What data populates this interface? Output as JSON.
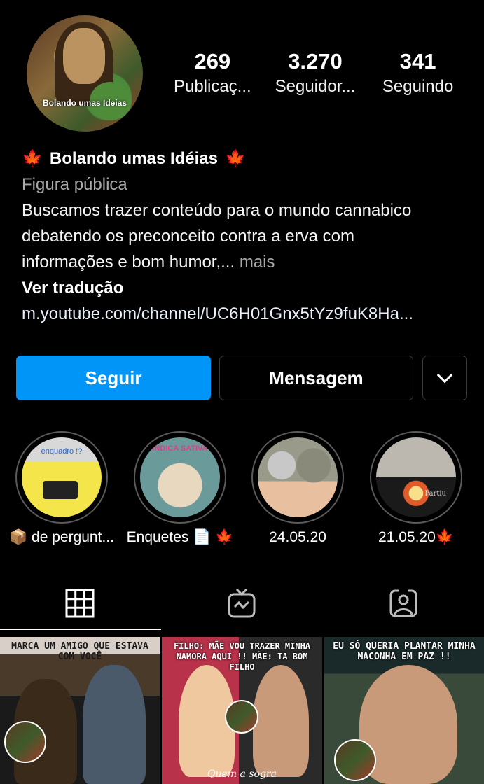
{
  "profile": {
    "avatar_label": "Bolando umas Ideias",
    "stats": [
      {
        "value": "269",
        "label": "Publicaç..."
      },
      {
        "value": "3.270",
        "label": "Seguidor..."
      },
      {
        "value": "341",
        "label": "Seguindo"
      }
    ],
    "name": "Bolando umas Idéias",
    "name_emoji": "🍁",
    "category": "Figura pública",
    "bio_line1": "Buscamos trazer conteúdo para o mundo cannabico",
    "bio_line2": "debatendo os preconceito contra a erva com",
    "bio_line3": "informações e bom humor,...",
    "more": "mais",
    "translate": "Ver tradução",
    "link": "m.youtube.com/channel/UC6H01Gnx5tYz9fuK8Ha..."
  },
  "actions": {
    "follow": "Seguir",
    "message": "Mensagem"
  },
  "highlights": [
    {
      "label": "📦 de pergunt...",
      "img_text": "enquadro !?"
    },
    {
      "label": "Enquetes 📄 🍁",
      "img_text": "INDICA  SATIVA"
    },
    {
      "label": "24.05.20",
      "img_text": ""
    },
    {
      "label": "21.05.20🍁",
      "img_text": "Partiu"
    }
  ],
  "tabs": [
    {
      "icon": "grid-icon",
      "active": true
    },
    {
      "icon": "igtv-icon",
      "active": false
    },
    {
      "icon": "tagged-icon",
      "active": false
    }
  ],
  "posts": [
    {
      "caption": "MARCA UM AMIGO QUE ESTAVA COM VOCÊ",
      "sub": ""
    },
    {
      "caption": "FILHO: MÃE VOU TRAZER MINHA NAMORA AQUI !! MÃE: TA BOM FILHO",
      "sub": "Quem a sogra"
    },
    {
      "caption": "EU SÓ QUERIA PLANTAR MINHA MACONHA EM PAZ !!",
      "sub": ""
    }
  ],
  "colors": {
    "accent": "#0095f6",
    "background": "#000000",
    "muted": "#a8a8a8"
  }
}
